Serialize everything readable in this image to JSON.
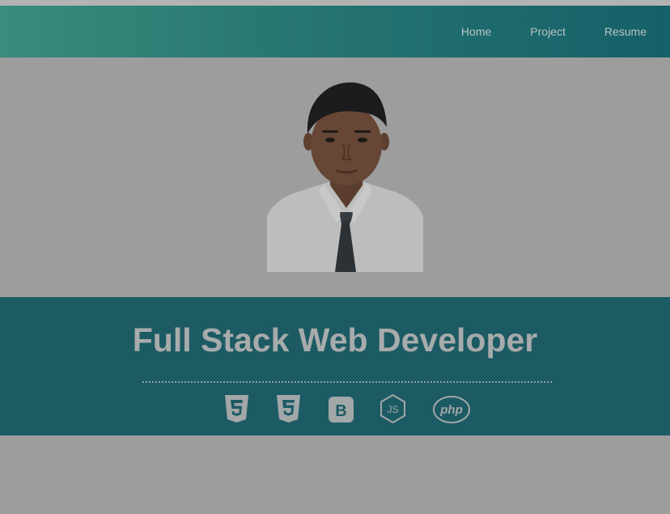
{
  "nav": {
    "items": [
      {
        "label": "Home"
      },
      {
        "label": "Project"
      },
      {
        "label": "Resume"
      }
    ]
  },
  "hero": {
    "title": "Full Stack Web Developer"
  },
  "tech": [
    {
      "icon": "html5-icon"
    },
    {
      "icon": "css3-icon"
    },
    {
      "icon": "bootstrap-icon",
      "glyph": "B"
    },
    {
      "icon": "nodejs-icon",
      "glyph": "JS"
    },
    {
      "icon": "php-icon",
      "glyph": "php"
    }
  ],
  "colors": {
    "navbar_start": "#3a8c7c",
    "navbar_end": "#166068",
    "band": "#1d5b64",
    "background": "#9d9d9d",
    "title_text": "#a7abab"
  }
}
